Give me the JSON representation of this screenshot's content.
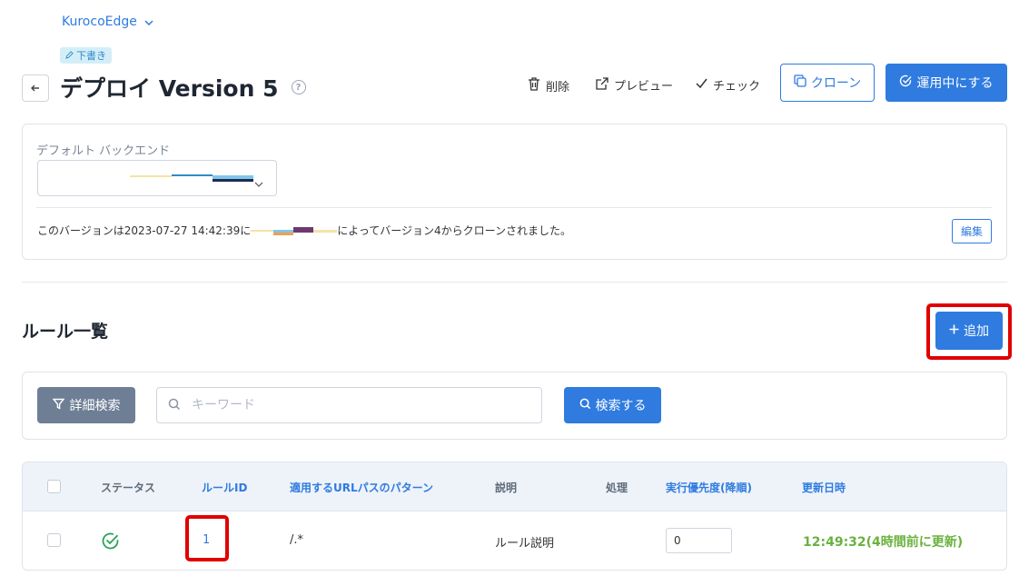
{
  "header": {
    "environment": "KurocoEdge",
    "draft_badge": "下書き",
    "title": "デプロイ Version 5"
  },
  "toolbar": {
    "delete_label": "削除",
    "preview_label": "プレビュー",
    "check_label": "チェック",
    "clone_label": "クローン",
    "activate_label": "運用中にする"
  },
  "backend": {
    "label": "デフォルト バックエンド",
    "info_prefix": "このバージョンは2023-07-27 14:42:39に",
    "info_suffix": "によってバージョン4からクローンされました。",
    "edit_label": "編集"
  },
  "rules": {
    "section_title": "ルール一覧",
    "add_label": "追加",
    "filter_label": "詳細検索",
    "search_placeholder": "キーワード",
    "search_button": "検索する",
    "columns": {
      "status": "ステータス",
      "rule_id": "ルールID",
      "url_pattern": "適用するURLパスのパターン",
      "description": "説明",
      "action": "処理",
      "priority": "実行優先度(降順)",
      "updated": "更新日時"
    },
    "rows": [
      {
        "id": "1",
        "pattern": "/.*",
        "description": "ルール説明",
        "priority": "0",
        "updated": "12:49:32(4時間前に更新)"
      }
    ]
  },
  "colors": {
    "primary": "#2f7be0",
    "success": "#6ab23e",
    "highlight": "#e00000",
    "filter_button": "#6e7f95"
  }
}
